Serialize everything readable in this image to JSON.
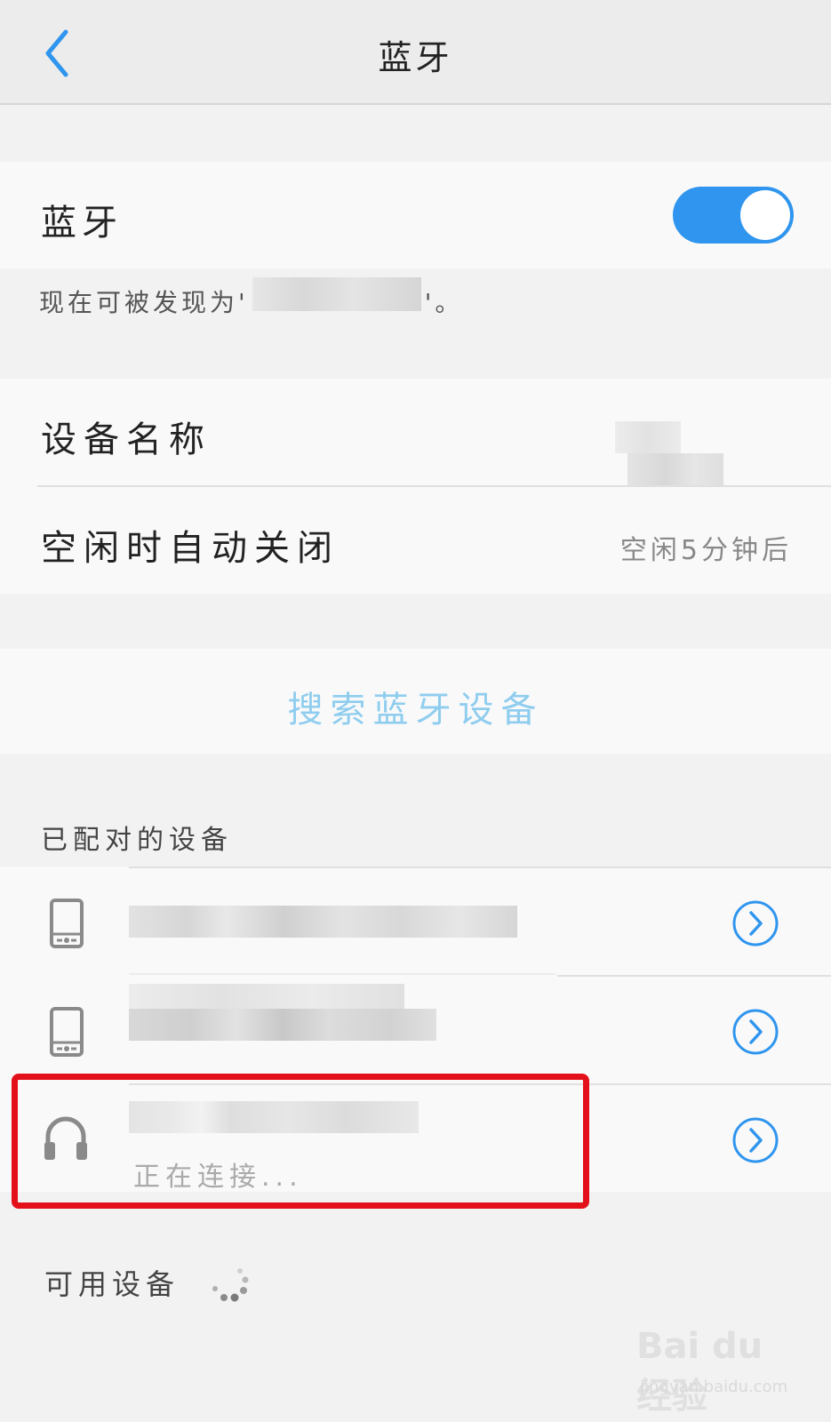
{
  "header": {
    "title": "蓝牙"
  },
  "bluetooth": {
    "label": "蓝牙",
    "enabled": true,
    "discoverable_prefix": "现在可被发现为'",
    "discoverable_suffix": "'。"
  },
  "settings": {
    "device_name_label": "设备名称",
    "auto_off_label": "空闲时自动关闭",
    "auto_off_value": "空闲5分钟后"
  },
  "search": {
    "label": "搜索蓝牙设备"
  },
  "paired": {
    "title": "已配对的设备",
    "devices": [
      {
        "icon": "phone-icon",
        "status": ""
      },
      {
        "icon": "phone-icon",
        "status": ""
      },
      {
        "icon": "headphones-icon",
        "status": "正在连接..."
      }
    ]
  },
  "available": {
    "title": "可用设备"
  },
  "watermark": {
    "main": "Bai du 经验",
    "sub": "jingyan.baidu.com"
  },
  "colors": {
    "accent": "#2f95ee",
    "search_text": "#8fcdef",
    "highlight": "#e3101a"
  }
}
